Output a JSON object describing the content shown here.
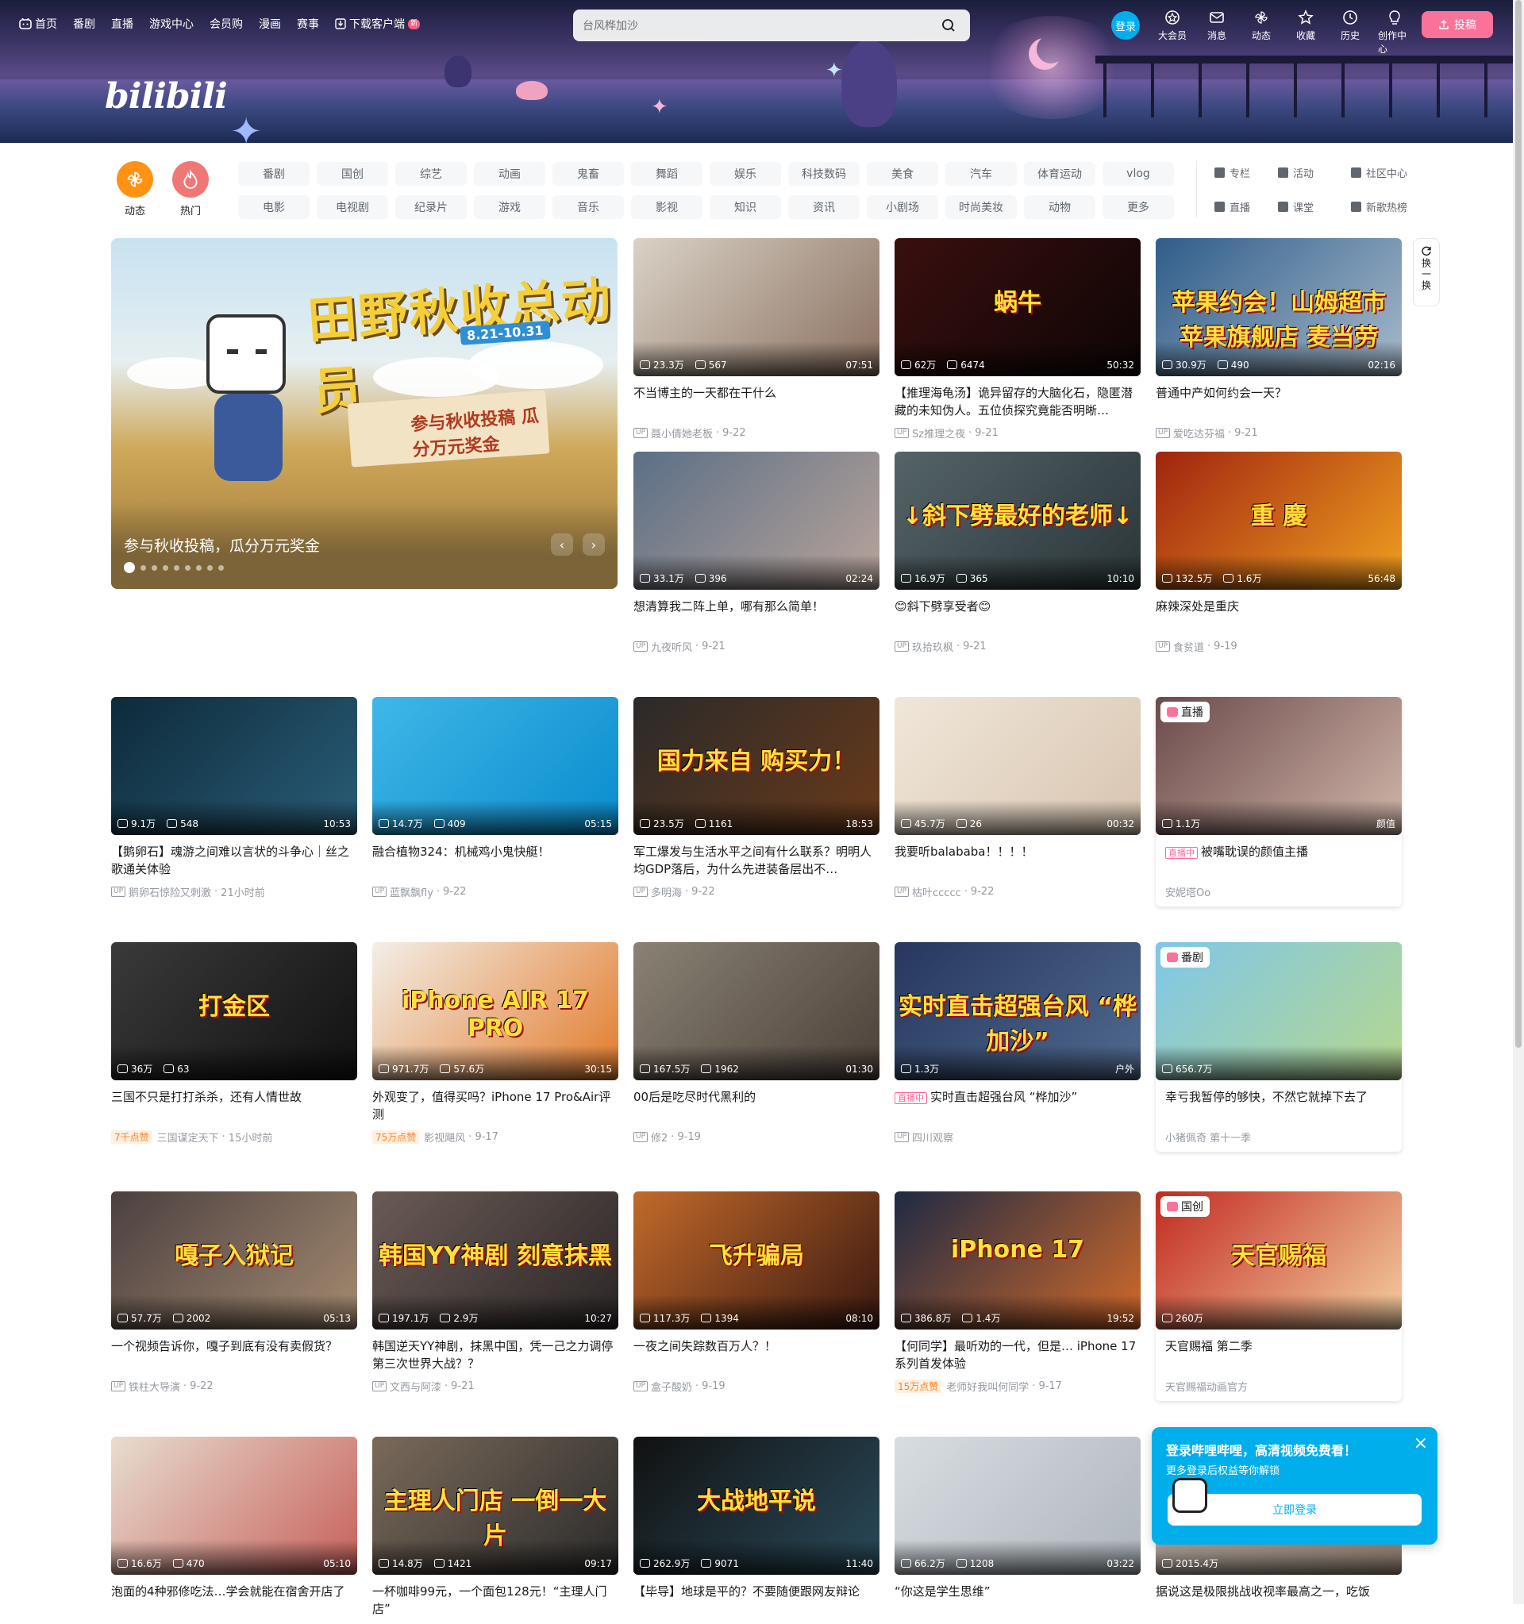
{
  "nav": {
    "home": "首页",
    "anime": "番剧",
    "live": "直播",
    "game": "游戏中心",
    "mall": "会员购",
    "manga": "漫画",
    "match": "赛事",
    "download": "下载客户端",
    "new_badge": "新"
  },
  "search": {
    "placeholder": "台风桦加沙"
  },
  "user": {
    "login": "登录",
    "vip": "大会员",
    "message": "消息",
    "dynamic": "动态",
    "favorite": "收藏",
    "history": "历史",
    "creator": "创作中心",
    "upload": "投稿"
  },
  "logo": "bilibili",
  "channels": {
    "dynamic": "动态",
    "hot": "热门",
    "tags": [
      "番剧",
      "国创",
      "综艺",
      "动画",
      "鬼畜",
      "舞蹈",
      "娱乐",
      "科技数码",
      "美食",
      "汽车",
      "体育运动",
      "vlog",
      "电影",
      "电视剧",
      "纪录片",
      "游戏",
      "音乐",
      "影视",
      "知识",
      "资讯",
      "小剧场",
      "时尚美妆",
      "动物",
      "更多"
    ],
    "links": [
      "专栏",
      "活动",
      "社区中心",
      "直播",
      "课堂",
      "新歌热榜"
    ]
  },
  "hero": {
    "caption": "参与秋收投稿，瓜分万元奖金",
    "art_title": "田野秋收总动员",
    "art_date": "8.21-10.31",
    "art_sub": "参与秋收投稿 瓜分万元奖金",
    "slides": 9,
    "current": 1
  },
  "refresh": {
    "label": "换一换"
  },
  "colors": {
    "accent": "#00aeec",
    "pink": "#fb7299"
  },
  "videos": [
    {
      "title": "不当博主的一天都在干什么",
      "author": "聂小倩她老板",
      "date": "9-22",
      "views": "23.3万",
      "danmaku": "567",
      "duration": "07:51",
      "thumb_text": ""
    },
    {
      "title": "【推理海龟汤】诡异留存的大脑化石，隐匿潜藏的未知伪人。五位侦探究竟能否明晰…",
      "author": "Sz推理之夜",
      "date": "9-21",
      "views": "62万",
      "danmaku": "6474",
      "duration": "50:32",
      "thumb_text": "蜗牛"
    },
    {
      "title": "普通中产如何约会一天？",
      "author": "爱吃达芬福",
      "date": "9-21",
      "views": "30.9万",
      "danmaku": "490",
      "duration": "02:16",
      "thumb_text": "苹果约会！山姆超市 苹果旗舰店 麦当劳"
    },
    {
      "title": "想清算我二阵上单，哪有那么简单！",
      "author": "九夜听风",
      "date": "9-21",
      "views": "33.1万",
      "danmaku": "396",
      "duration": "02:24",
      "thumb_text": ""
    },
    {
      "title": "😊斜下劈享受者😊",
      "author": "玖拾玖枫",
      "date": "9-21",
      "views": "16.9万",
      "danmaku": "365",
      "duration": "10:10",
      "thumb_text": "↓斜下劈最好的老师↓"
    },
    {
      "title": "麻辣深处是重庆",
      "author": "食贫道",
      "date": "9-19",
      "views": "132.5万",
      "danmaku": "1.6万",
      "duration": "56:48",
      "thumb_text": "重 慶"
    },
    {
      "title": "【鹅卵石】魂游之间难以言状的斗争心｜丝之歌通关体验",
      "author": "鹅卵石惊险又刺激",
      "date": "21小时前",
      "views": "9.1万",
      "danmaku": "548",
      "duration": "10:53",
      "thumb_text": ""
    },
    {
      "title": "融合植物324：机械鸡小鬼快艇！",
      "author": "蓝飘飘fly",
      "date": "9-22",
      "views": "14.7万",
      "danmaku": "409",
      "duration": "05:15",
      "thumb_text": ""
    },
    {
      "title": "军工爆发与生活水平之间有什么联系？明明人均GDP落后，为什么先进装备层出不…",
      "author": "多明海",
      "date": "9-22",
      "views": "23.5万",
      "danmaku": "1161",
      "duration": "18:53",
      "thumb_text": "国力来自 购买力！"
    },
    {
      "title": "我要听balababa！！！！",
      "author": "枯叶ccccc",
      "date": "9-22",
      "views": "45.7万",
      "danmaku": "26",
      "duration": "00:32",
      "thumb_text": ""
    },
    {
      "title": "被嘴耽误的颜值主播",
      "author": "安妮塔Oo",
      "date": "",
      "views": "1.1万",
      "danmaku": "",
      "duration": "颜值",
      "thumb_text": "",
      "tag": "直播",
      "live": "直播中"
    },
    {
      "title": "三国不只是打打杀杀，还有人情世故",
      "author": "三国谋定天下",
      "date": "15小时前",
      "views": "36万",
      "danmaku": "63",
      "duration": "",
      "thumb_text": "打金区",
      "badge": "7千点赞"
    },
    {
      "title": "外观变了，值得买吗？iPhone 17 Pro&Air评测",
      "author": "影视飓风",
      "date": "9-17",
      "views": "971.7万",
      "danmaku": "57.6万",
      "duration": "30:15",
      "thumb_text": "iPhone AIR  17 PRO",
      "badge": "75万点赞"
    },
    {
      "title": "00后是吃尽时代黑利的",
      "author": "修2",
      "date": "9-19",
      "views": "167.5万",
      "danmaku": "1962",
      "duration": "01:30",
      "thumb_text": ""
    },
    {
      "title": "实时直击超强台风 “桦加沙”",
      "author": "四川观察",
      "date": "",
      "views": "1.3万",
      "danmaku": "",
      "duration": "户外",
      "thumb_text": "实时直击超强台风 “桦加沙”",
      "live": "直播中"
    },
    {
      "title": "幸亏我暂停的够快，不然它就掉下去了",
      "author": "小猪佩奇 第十一季",
      "date": "",
      "views": "656.7万",
      "danmaku": "",
      "duration": "",
      "thumb_text": "",
      "tag": "番剧"
    },
    {
      "title": "一个视频告诉你，嘎子到底有没有卖假货？",
      "author": "铁柱大导演",
      "date": "9-22",
      "views": "57.7万",
      "danmaku": "2002",
      "duration": "05:13",
      "thumb_text": "嘎子入狱记"
    },
    {
      "title": "韩国逆天YY神剧，抹黑中国，凭一己之力调停第三次世界大战？？",
      "author": "文西与阿漆",
      "date": "9-21",
      "views": "197.1万",
      "danmaku": "2.9万",
      "duration": "10:27",
      "thumb_text": "韩国YY神剧 刻意抹黑"
    },
    {
      "title": "一夜之间失踪数百万人？！",
      "author": "盒子酸奶",
      "date": "9-19",
      "views": "117.3万",
      "danmaku": "1394",
      "duration": "08:10",
      "thumb_text": "飞升骗局"
    },
    {
      "title": "【何同学】最听劝的一代，但是… iPhone 17系列首发体验",
      "author": "老师好我叫何同学",
      "date": "9-17",
      "views": "386.8万",
      "danmaku": "1.4万",
      "duration": "19:52",
      "thumb_text": "iPhone 17",
      "badge": "15万点赞"
    },
    {
      "title": "天官赐福 第二季",
      "author": "天官赐福动画官方",
      "date": "",
      "views": "260万",
      "danmaku": "",
      "duration": "",
      "thumb_text": "天官赐福",
      "tag": "国创"
    },
    {
      "title": "泡面的4种邪修吃法…学会就能在宿舍开店了",
      "author": "",
      "date": "",
      "views": "16.6万",
      "danmaku": "470",
      "duration": "05:10",
      "thumb_text": ""
    },
    {
      "title": "一杯咖啡99元，一个面包128元！“主理人门店”",
      "author": "",
      "date": "",
      "views": "14.8万",
      "danmaku": "1421",
      "duration": "09:17",
      "thumb_text": "主理人门店 一倒一大片"
    },
    {
      "title": "【毕导】地球是平的？不要随便跟网友辩论",
      "author": "",
      "date": "",
      "views": "262.9万",
      "danmaku": "9071",
      "duration": "11:40",
      "thumb_text": "大战地平说"
    },
    {
      "title": "“你这是学生思维”",
      "author": "",
      "date": "",
      "views": "66.2万",
      "danmaku": "1208",
      "duration": "03:22",
      "thumb_text": ""
    },
    {
      "title": "据说这是极限挑战收视率最高之一，吃饭",
      "author": "",
      "date": "",
      "views": "2015.4万",
      "danmaku": "",
      "duration": "",
      "thumb_text": ""
    }
  ],
  "popup": {
    "title": "登录哔哩哔哩，高清视频免费看！",
    "subtitle": "更多登录后权益等你解锁",
    "button": "立即登录"
  }
}
